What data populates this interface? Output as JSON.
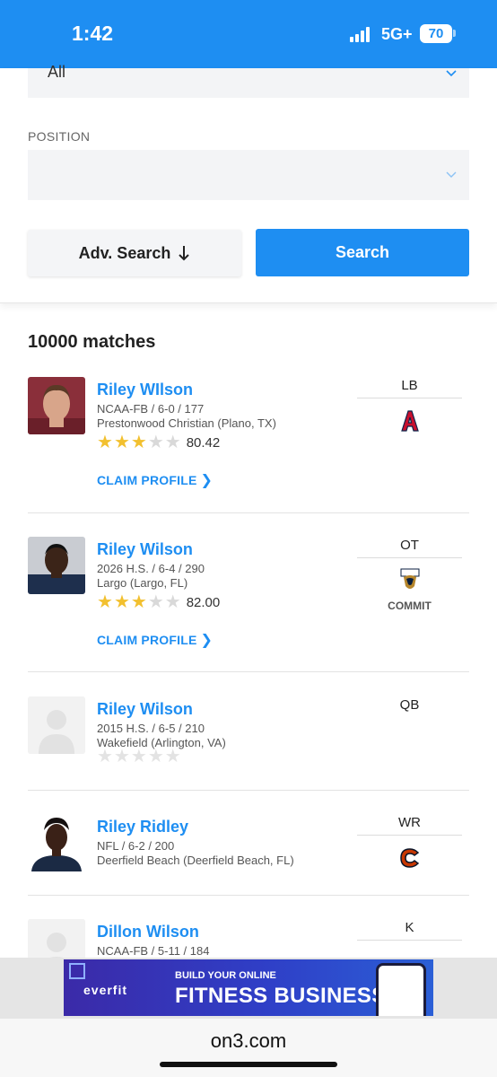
{
  "status": {
    "time": "1:42",
    "network": "5G+",
    "battery": "70"
  },
  "filters": {
    "first_select_value": "All",
    "position_label": "POSITION",
    "position_value": "",
    "adv_search_label": "Adv. Search",
    "search_label": "Search"
  },
  "results": {
    "count_label": "10000 matches",
    "claim_label": "CLAIM PROFILE",
    "commit_label": "COMMIT",
    "players": [
      {
        "name": "Riley WIlson",
        "line1": "NCAA-FB / 6-0 / 177",
        "line2": "Prestonwood Christian (Plano, TX)",
        "stars": 3,
        "rating": "80.42",
        "position": "LB",
        "team_logo": "arizona-logo-icon",
        "claimable": true,
        "committed": false
      },
      {
        "name": "Riley Wilson",
        "line1": "2026 H.S. / 6-4 / 290",
        "line2": "Largo (Largo, FL)",
        "stars": 3,
        "rating": "82.00",
        "position": "OT",
        "team_logo": "fiu-logo-icon",
        "claimable": true,
        "committed": true
      },
      {
        "name": "Riley Wilson",
        "line1": "2015 H.S. / 6-5 / 210",
        "line2": "Wakefield (Arlington, VA)",
        "stars": 0,
        "rating": "",
        "position": "QB",
        "team_logo": "",
        "claimable": false,
        "committed": false
      },
      {
        "name": "Riley Ridley",
        "line1": "NFL / 6-2 / 200",
        "line2": "Deerfield Beach (Deerfield Beach, FL)",
        "stars": null,
        "rating": "",
        "position": "WR",
        "team_logo": "bears-logo-icon",
        "claimable": false,
        "committed": false
      },
      {
        "name": "Dillon Wilson",
        "line1": "NCAA-FB / 5-11 / 184",
        "line2": "",
        "stars": null,
        "rating": "",
        "position": "K",
        "team_logo": "",
        "claimable": false,
        "committed": false
      }
    ]
  },
  "ad": {
    "brand": "everfit",
    "line1": "BUILD YOUR ONLINE",
    "line2": "FITNESS BUSINESS"
  },
  "browser": {
    "url": "on3.com"
  },
  "colors": {
    "accent": "#1e8ef2",
    "star_filled": "#f2c02f",
    "star_empty": "#d9d9d9"
  }
}
